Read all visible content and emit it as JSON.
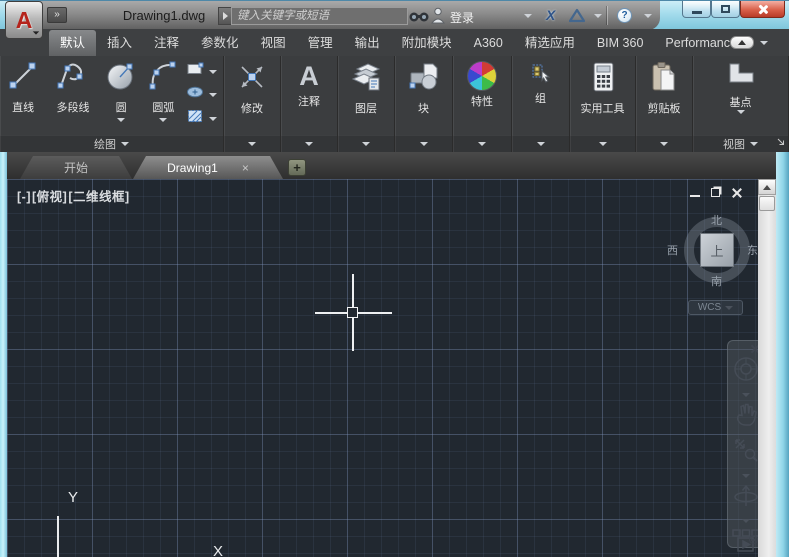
{
  "titlebar": {
    "app_glyph": "A",
    "overflow_glyph": "»",
    "document_title": "Drawing1.dwg",
    "search_placeholder": "键入关键字或短语",
    "signin_label": "登录",
    "exchange_glyph": "X",
    "help_glyph": "?"
  },
  "ribbon": {
    "tabs": [
      {
        "label": "默认",
        "active": true
      },
      {
        "label": "插入"
      },
      {
        "label": "注释"
      },
      {
        "label": "参数化"
      },
      {
        "label": "视图"
      },
      {
        "label": "管理"
      },
      {
        "label": "输出"
      },
      {
        "label": "附加模块"
      },
      {
        "label": "A360"
      },
      {
        "label": "精选应用"
      },
      {
        "label": "BIM 360"
      },
      {
        "label": "Performance"
      }
    ],
    "panels": {
      "draw": {
        "title": "绘图",
        "line": "直线",
        "polyline": "多段线",
        "circle": "圆",
        "arc": "圆弧"
      },
      "modify": {
        "title": "修改"
      },
      "annotate": {
        "title": "注释",
        "icon_glyph": "A"
      },
      "layers": {
        "title": "图层"
      },
      "block": {
        "title": "块"
      },
      "properties": {
        "title": "特性"
      },
      "group": {
        "title": "组"
      },
      "utilities": {
        "title": "实用工具"
      },
      "clipboard": {
        "title": "剪贴板"
      },
      "view": {
        "title": "视图",
        "base_label": "基点"
      }
    }
  },
  "file_tabs": {
    "start": "开始",
    "drawing": "Drawing1",
    "close_glyph": "×",
    "new_glyph": "+"
  },
  "viewport": {
    "minimize": "[-]",
    "view_name": "[俯视]",
    "visual_style": "[二维线框]"
  },
  "viewcube": {
    "north": "北",
    "south": "南",
    "west": "西",
    "east": "东",
    "face": "上",
    "wcs": "WCS"
  },
  "ucs": {
    "x": "X",
    "y": "Y"
  },
  "colors": {
    "drawing_bg": "#212830",
    "grid_minor": "#2a313d",
    "grid_major": "#364153",
    "titlebar_aero": "#9ed8e8",
    "ribbon_bg": "#3b3d3f",
    "close_button": "#c8574a"
  }
}
